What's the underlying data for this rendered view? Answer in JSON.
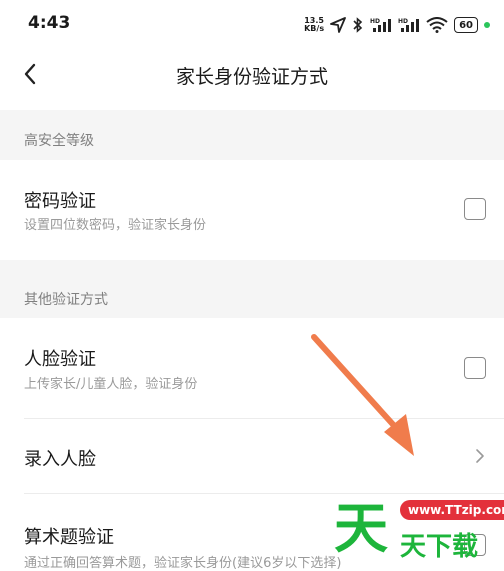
{
  "status_bar": {
    "time": "4:43",
    "net_speed_value": "13.5",
    "net_speed_unit": "KB/s",
    "battery": "60",
    "icons": [
      "location-arrow-icon",
      "bluetooth-icon",
      "signal-hd-1-icon",
      "signal-hd-2-icon",
      "wifi-icon",
      "battery-icon"
    ]
  },
  "header": {
    "title": "家长身份验证方式"
  },
  "sections": [
    {
      "label": "高安全等级",
      "rows": [
        {
          "title": "密码验证",
          "subtitle": "设置四位数密码，验证家长身份",
          "control": "checkbox",
          "checked": false
        }
      ]
    },
    {
      "label": "其他验证方式",
      "rows": [
        {
          "title": "人脸验证",
          "subtitle": "上传家长/儿童人脸，验证身份",
          "control": "checkbox",
          "checked": false
        },
        {
          "title": "录入人脸",
          "subtitle": "",
          "control": "chevron"
        },
        {
          "title": "算术题验证",
          "subtitle": "通过正确回答算术题，验证家长身份(建议6岁以下选择)",
          "control": "checkbox",
          "checked": false
        }
      ]
    }
  ],
  "watermark": {
    "big_char": "天",
    "url": "www.TTzip.com",
    "text": "天下载"
  },
  "colors": {
    "accent_status_dot": "#2bc55b",
    "annotation_arrow": "#f07c4c",
    "section_bg": "#f5f5f5",
    "watermark_green": "#1db53b",
    "watermark_red": "#e3313b"
  }
}
